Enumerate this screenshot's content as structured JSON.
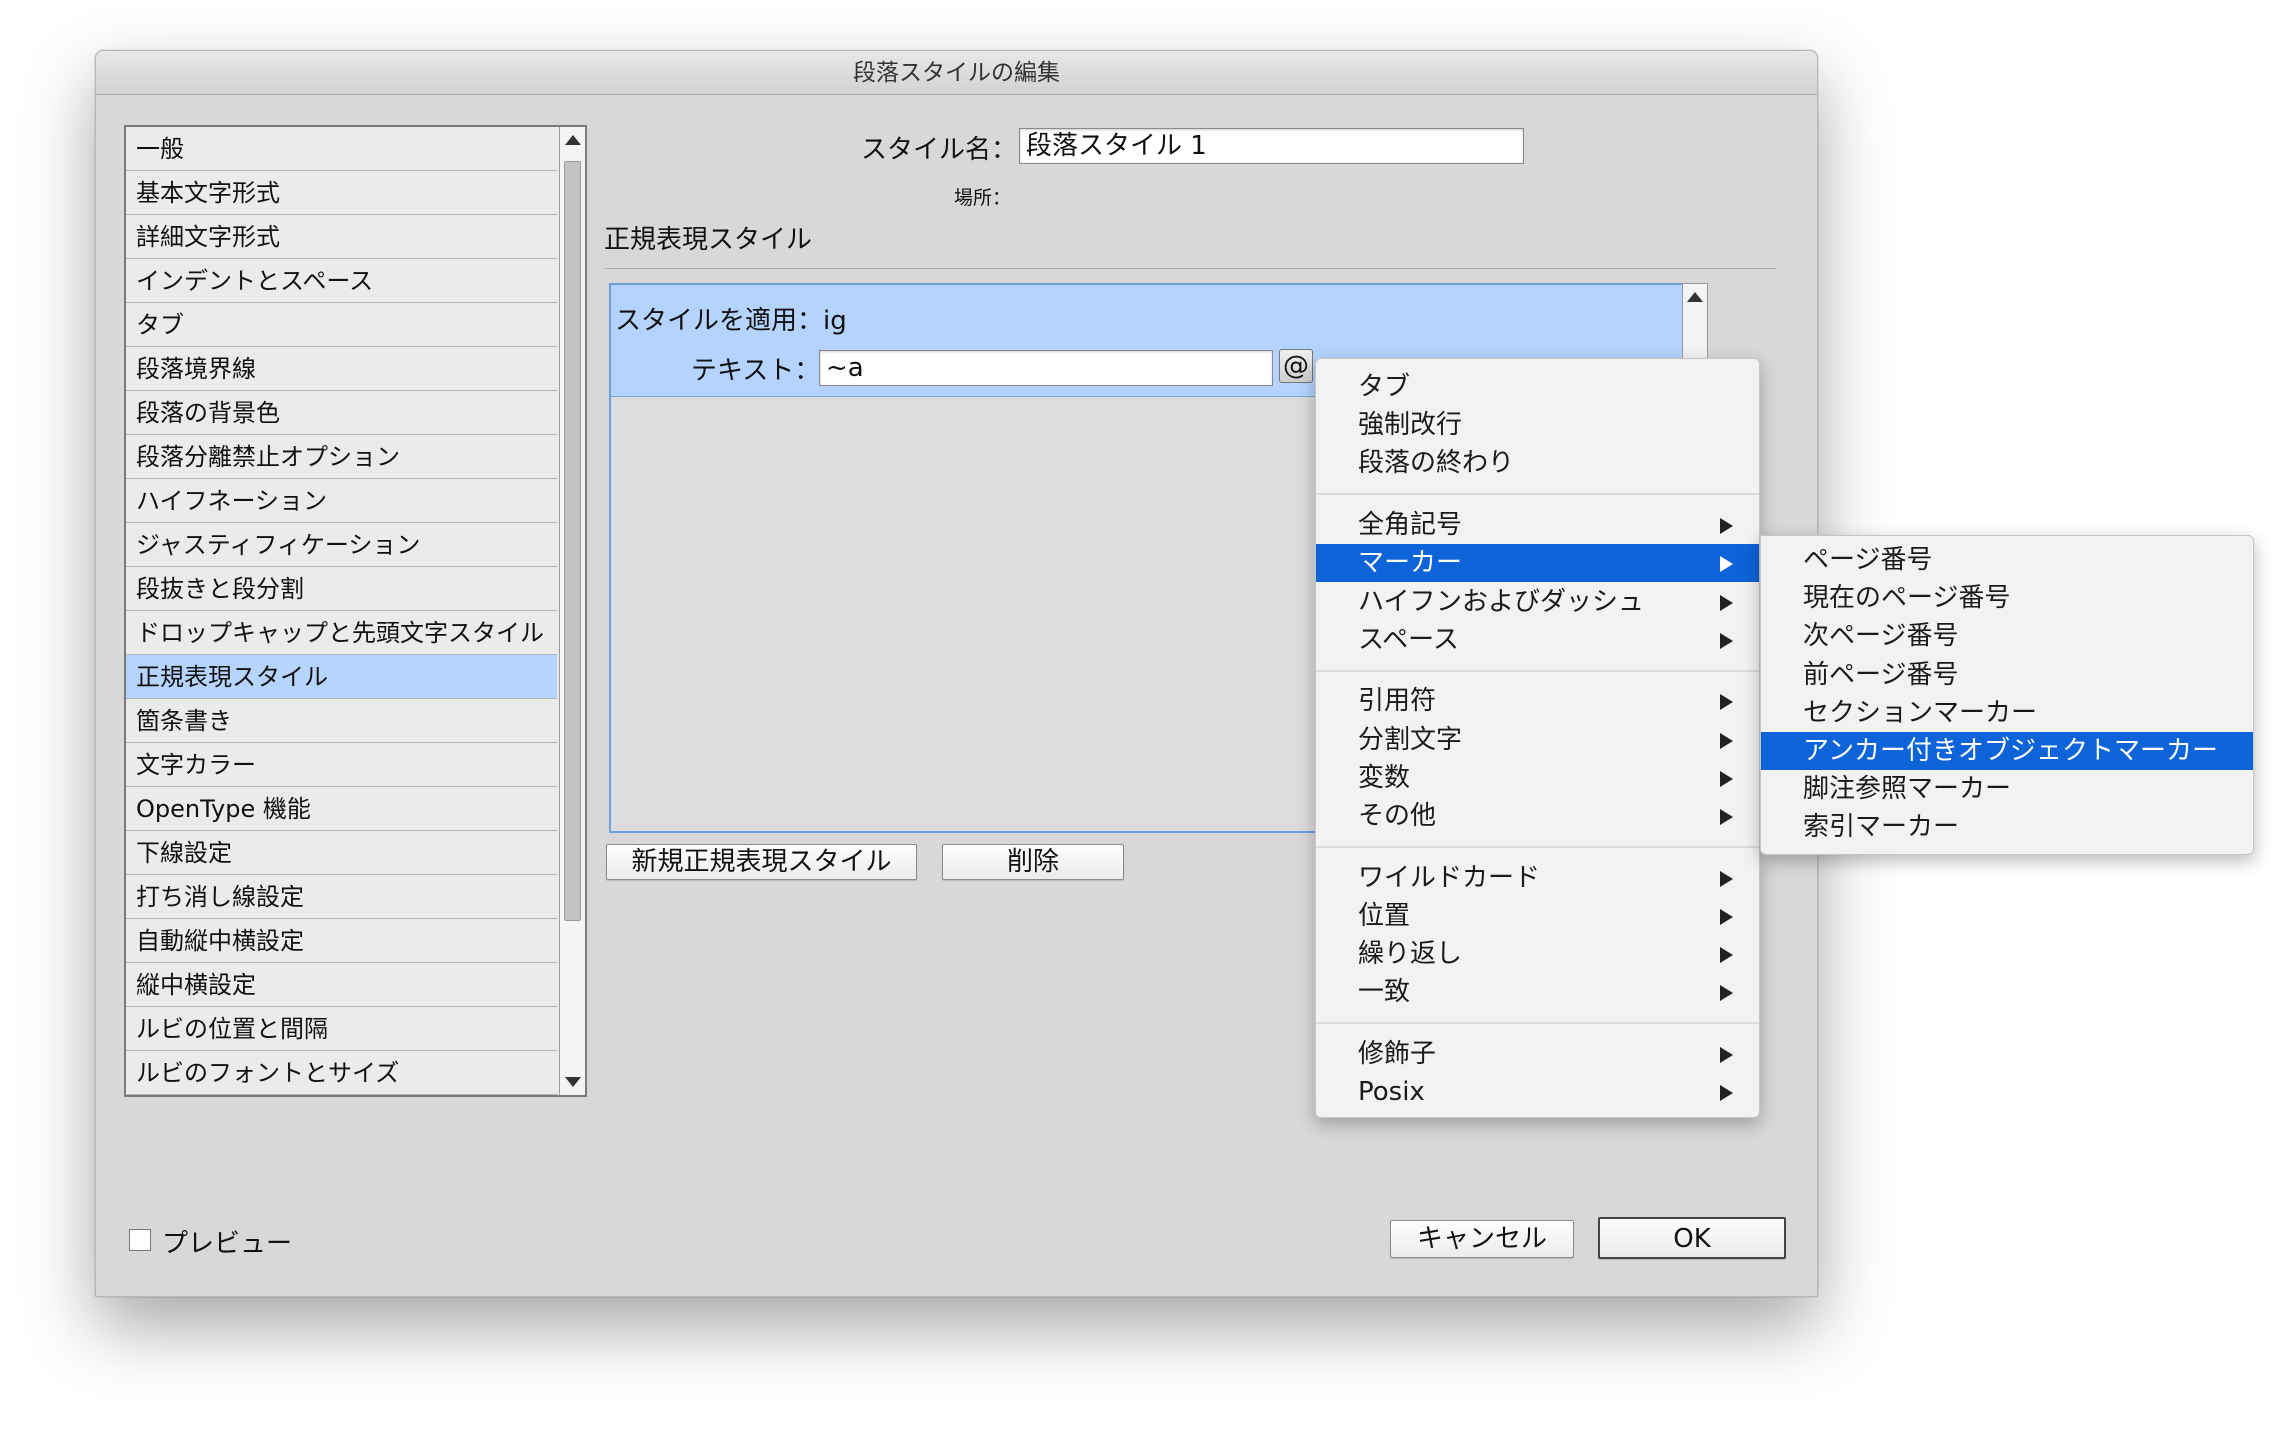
{
  "window": {
    "title": "段落スタイルの編集"
  },
  "categories": [
    "一般",
    "基本文字形式",
    "詳細文字形式",
    "インデントとスペース",
    "タブ",
    "段落境界線",
    "段落の背景色",
    "段落分離禁止オプション",
    "ハイフネーション",
    "ジャスティフィケーション",
    "段抜きと段分割",
    "ドロップキャップと先頭文字スタイル",
    "正規表現スタイル",
    "箇条書き",
    "文字カラー",
    "OpenType 機能",
    "下線設定",
    "打ち消し線設定",
    "自動縦中横設定",
    "縦中横設定",
    "ルビの位置と間隔",
    "ルビのフォントとサイズ"
  ],
  "selected_category": "正規表現スタイル",
  "style_name": {
    "label": "スタイル名：",
    "value": "段落スタイル 1"
  },
  "location": {
    "label": "場所："
  },
  "section_title": "正規表現スタイル",
  "grep_style": {
    "apply_label": "スタイルを適用：ig",
    "text_label": "テキスト：",
    "text_value": "~a",
    "special_char_button": "@"
  },
  "buttons": {
    "new_grep": "新規正規表現スタイル",
    "delete": "削除",
    "cancel": "キャンセル",
    "ok": "OK"
  },
  "preview": {
    "label": "プレビュー",
    "checked": false
  },
  "special_menu": {
    "groups": [
      [
        {
          "label": "タブ"
        },
        {
          "label": "強制改行"
        },
        {
          "label": "段落の終わり"
        }
      ],
      [
        {
          "label": "全角記号",
          "sub": true
        },
        {
          "label": "マーカー",
          "sub": true,
          "highlighted": true
        },
        {
          "label": "ハイフンおよびダッシュ",
          "sub": true
        },
        {
          "label": "スペース",
          "sub": true
        }
      ],
      [
        {
          "label": "引用符",
          "sub": true
        },
        {
          "label": "分割文字",
          "sub": true
        },
        {
          "label": "変数",
          "sub": true
        },
        {
          "label": "その他",
          "sub": true
        }
      ],
      [
        {
          "label": "ワイルドカード",
          "sub": true
        },
        {
          "label": "位置",
          "sub": true
        },
        {
          "label": "繰り返し",
          "sub": true
        },
        {
          "label": "一致",
          "sub": true
        }
      ],
      [
        {
          "label": "修飾子",
          "sub": true
        },
        {
          "label": "Posix",
          "sub": true
        }
      ]
    ]
  },
  "marker_submenu": {
    "items": [
      {
        "label": "ページ番号"
      },
      {
        "label": "現在のページ番号"
      },
      {
        "label": "次ページ番号"
      },
      {
        "label": "前ページ番号"
      },
      {
        "label": "セクションマーカー"
      },
      {
        "label": "アンカー付きオブジェクトマーカー",
        "highlighted": true
      },
      {
        "label": "脚注参照マーカー"
      },
      {
        "label": "索引マーカー"
      }
    ]
  },
  "colors": {
    "selection": "#b5d5ff",
    "menu_highlight": "#0d63d8",
    "dialog_bg": "#d8d8d8"
  }
}
